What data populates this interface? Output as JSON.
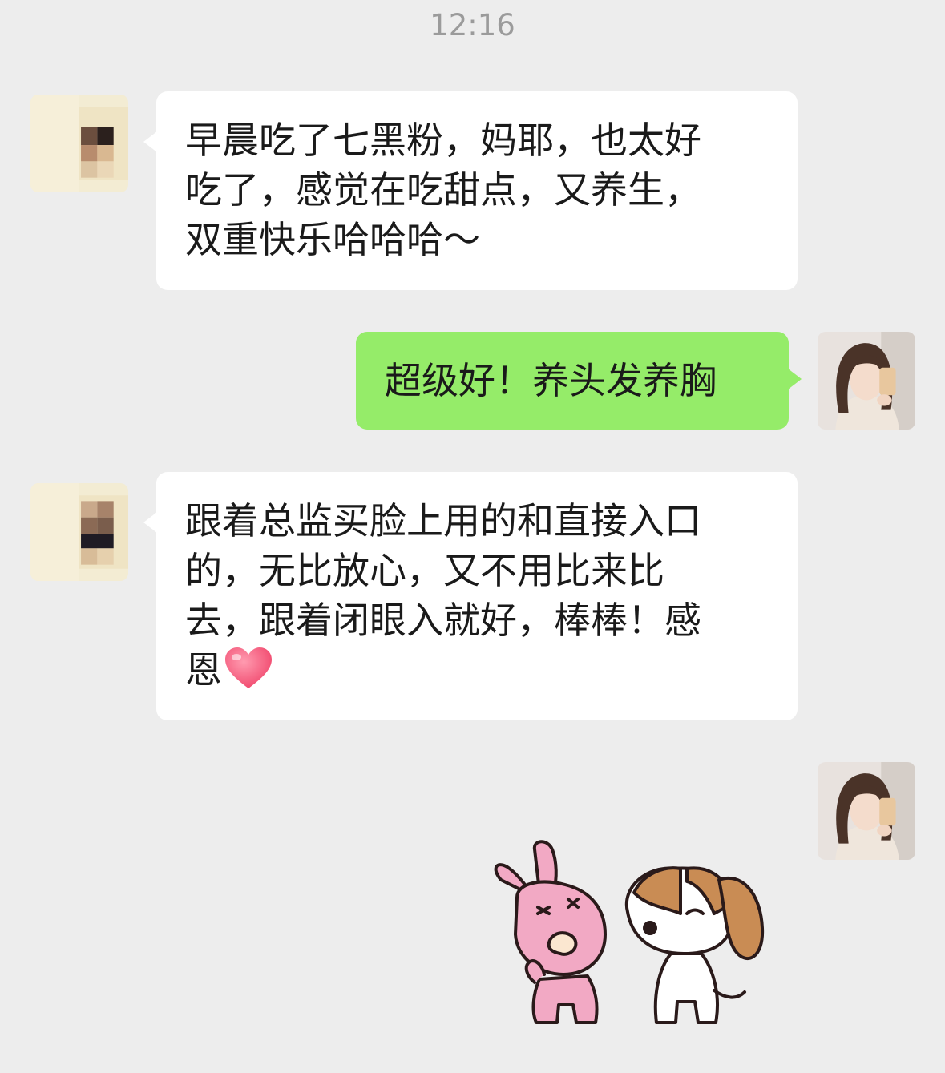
{
  "chat": {
    "timestamp": "12:16",
    "messages": [
      {
        "direction": "incoming",
        "lines": [
          "早晨吃了七黑粉，妈耶，也太好",
          "吃了，感觉在吃甜点，又养生，",
          "双重快乐哈哈哈～"
        ]
      },
      {
        "direction": "outgoing",
        "text": "超级好！养头发养胸"
      },
      {
        "direction": "incoming",
        "lines": [
          "跟着总监买脸上用的和直接入口",
          "的，无比放心，又不用比来比",
          "去，跟着闭眼入就好，棒棒！感",
          "恩"
        ],
        "emoji": "heart"
      },
      {
        "direction": "outgoing",
        "type": "sticker",
        "sticker": "rabbit-and-puppy"
      }
    ]
  }
}
